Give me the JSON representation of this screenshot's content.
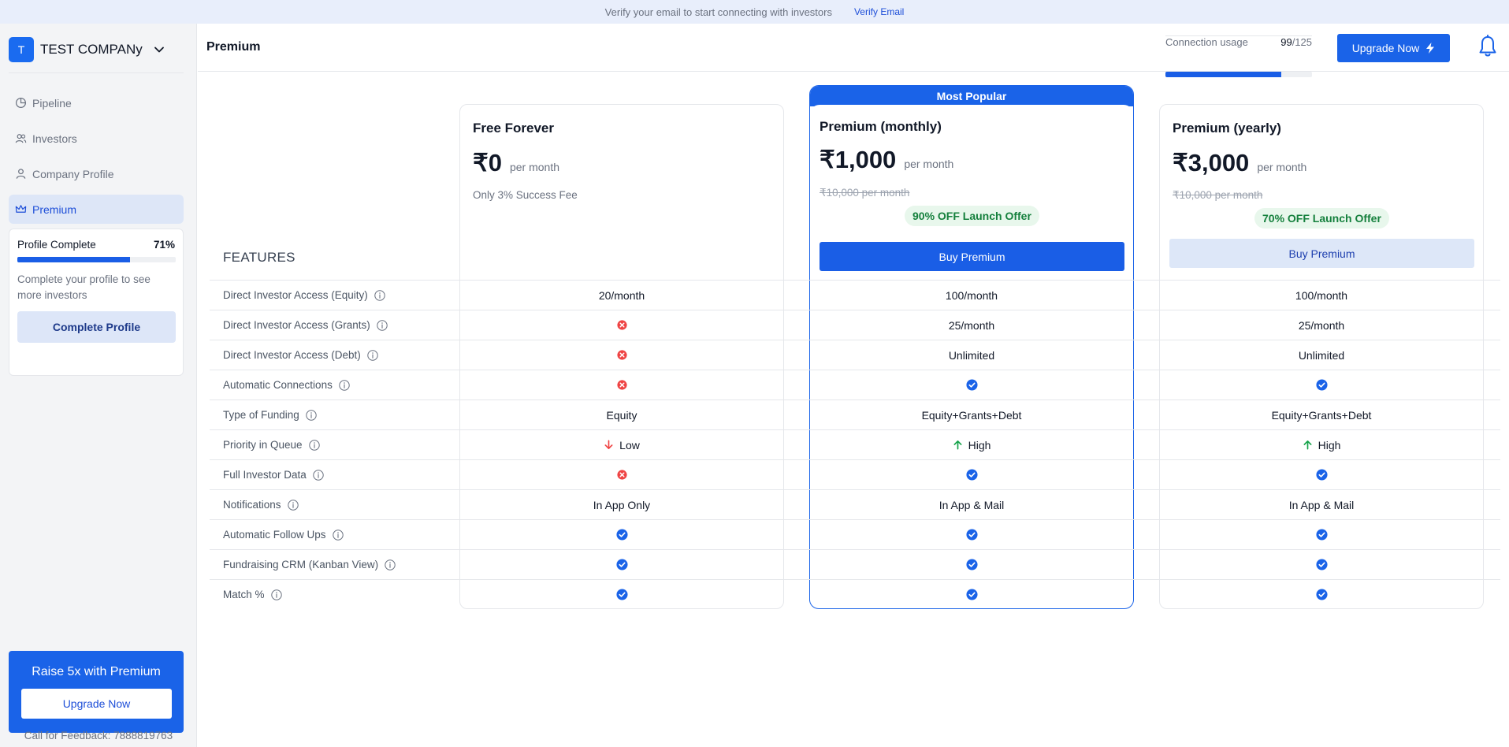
{
  "banner": {
    "message": "Verify your email to start connecting with investors",
    "link": "Verify Email"
  },
  "sidebar": {
    "company_initial": "T",
    "company_name": "TEST COMPANy",
    "nav": [
      {
        "label": "Pipeline",
        "icon": "pie-chart-icon"
      },
      {
        "label": "Investors",
        "icon": "users-icon"
      },
      {
        "label": "Company Profile",
        "icon": "user-icon"
      },
      {
        "label": "Premium",
        "icon": "crown-icon",
        "active": true
      }
    ],
    "profile": {
      "label": "Profile Complete",
      "percent_text": "71%",
      "percent": 0.71,
      "text": "Complete your profile to see more investors",
      "button": "Complete Profile"
    },
    "promo": {
      "title": "Raise 5x with Premium",
      "button": "Upgrade Now"
    },
    "feedback": "Call for Feedback: 7888819763"
  },
  "header": {
    "title": "Premium",
    "usage_label": "Connection usage",
    "usage_used": "99",
    "usage_total": "/125",
    "usage_fraction": 0.792,
    "upgrade_button": "Upgrade Now"
  },
  "pricing": {
    "features_heading": "FEATURES",
    "popular_label": "Most Popular",
    "plans": [
      {
        "name": "Free Forever",
        "price": "₹0",
        "per": "per month",
        "note": "Only 3% Success Fee"
      },
      {
        "name": "Premium (monthly)",
        "price": "₹1,000",
        "per": "per month",
        "original": "₹10,000 per month",
        "offer": "90% OFF Launch Offer",
        "button": "Buy Premium"
      },
      {
        "name": "Premium (yearly)",
        "price": "₹3,000",
        "per": "per month",
        "original": "₹10,000 per month",
        "offer": "70% OFF Launch Offer",
        "button": "Buy Premium"
      }
    ],
    "features": [
      {
        "name": "Direct Investor Access (Equity)",
        "values": [
          "20/month",
          "100/month",
          "100/month"
        ]
      },
      {
        "name": "Direct Investor Access (Grants)",
        "values": [
          "x",
          "25/month",
          "25/month"
        ]
      },
      {
        "name": "Direct Investor Access (Debt)",
        "values": [
          "x",
          "Unlimited",
          "Unlimited"
        ]
      },
      {
        "name": "Automatic Connections",
        "values": [
          "x",
          "check",
          "check"
        ]
      },
      {
        "name": "Type of Funding",
        "values": [
          "Equity",
          "Equity+Grants+Debt",
          "Equity+Grants+Debt"
        ]
      },
      {
        "name": "Priority in Queue",
        "values": [
          "down:Low",
          "up:High",
          "up:High"
        ]
      },
      {
        "name": "Full Investor Data",
        "values": [
          "x",
          "check",
          "check"
        ]
      },
      {
        "name": "Notifications",
        "values": [
          "In App Only",
          "In App & Mail",
          "In App & Mail"
        ]
      },
      {
        "name": "Automatic Follow Ups",
        "values": [
          "check",
          "check",
          "check"
        ]
      },
      {
        "name": "Fundraising CRM (Kanban View)",
        "values": [
          "check",
          "check",
          "check"
        ]
      },
      {
        "name": "Match %",
        "values": [
          "check",
          "check",
          "check"
        ]
      }
    ]
  },
  "colors": {
    "accent": "#1a63e8",
    "success": "#15803d",
    "danger": "#ef4444"
  }
}
